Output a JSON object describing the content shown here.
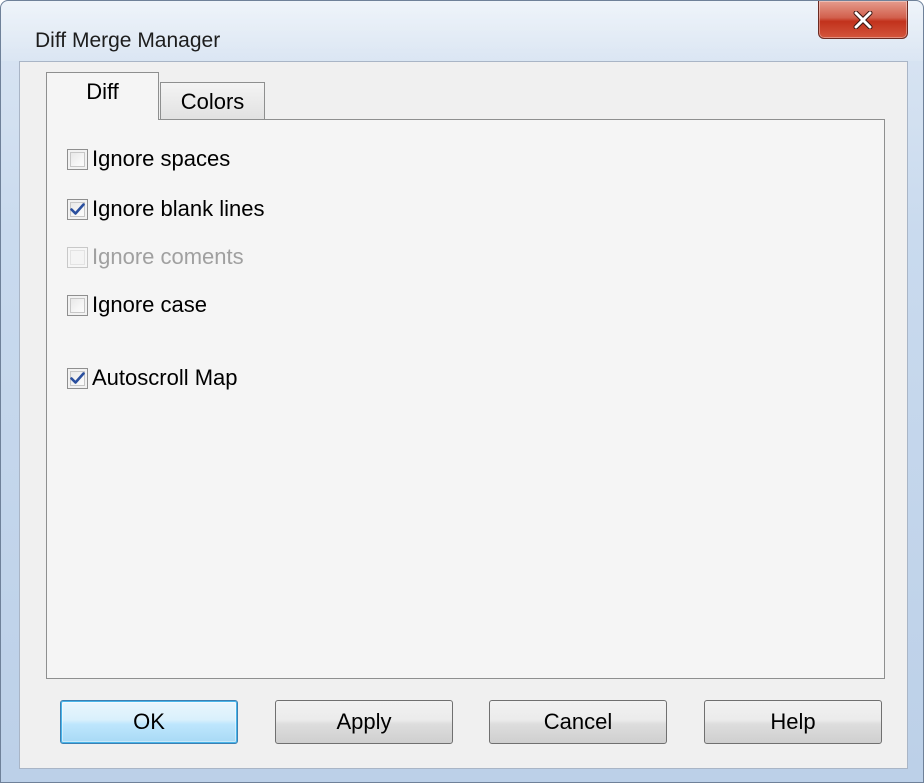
{
  "window": {
    "title": "Diff Merge Manager",
    "close_icon": "close-x-icon",
    "close_color": "#c7432d"
  },
  "tabs": [
    {
      "label": "Diff",
      "selected": true
    },
    {
      "label": "Colors",
      "selected": false
    }
  ],
  "options": [
    {
      "label": "Ignore spaces",
      "checked": false,
      "enabled": true
    },
    {
      "label": "Ignore blank lines",
      "checked": true,
      "enabled": true
    },
    {
      "label": "Ignore coments",
      "checked": false,
      "enabled": false
    },
    {
      "label": "Ignore case",
      "checked": false,
      "enabled": true
    },
    {
      "label": "Autoscroll Map",
      "checked": true,
      "enabled": true
    }
  ],
  "buttons": {
    "ok": "OK",
    "apply": "Apply",
    "cancel": "Cancel",
    "help": "Help"
  },
  "colors": {
    "check_mark": "#2a4f9e",
    "default_button_border": "#3c7fb1"
  }
}
